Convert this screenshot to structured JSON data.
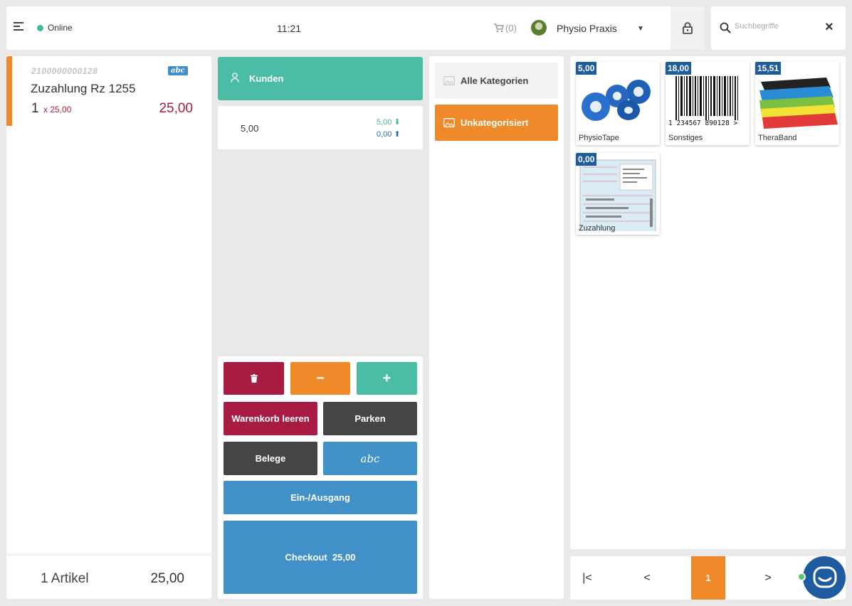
{
  "topbar": {
    "status": "Online",
    "time": "11:21",
    "cart_count": "(0)",
    "user_name": "Physio Praxis"
  },
  "search": {
    "placeholder": "Suchbegriffe",
    "clear": "×"
  },
  "cart": {
    "item": {
      "code": "2100000000128",
      "badge": "abc",
      "name": "Zuzahlung Rz 1255",
      "qty": "1",
      "unit": "x 25,00",
      "total": "25,00"
    },
    "footer": {
      "count": "1 Artikel",
      "sum": "25,00"
    }
  },
  "customer": {
    "label": "Kunden"
  },
  "payment": {
    "amount": "5,00",
    "in": "5,00",
    "out": "0,00"
  },
  "actions": {
    "minus": "−",
    "plus": "+",
    "clear_cart": "Warenkorb leeren",
    "park": "Parken",
    "receipts": "Belege",
    "abc": "abc",
    "cash_in_out": "Ein-/Ausgang",
    "checkout": "Checkout  25,00"
  },
  "categories": [
    {
      "label": "Alle Kategorien",
      "active": false
    },
    {
      "label": "Unkategorisiert",
      "active": true
    }
  ],
  "products": [
    {
      "price": "5,00",
      "name": "PhysioTape"
    },
    {
      "price": "18,00",
      "name": "Sonstiges",
      "barcode_text": "1 234567 890128 >"
    },
    {
      "price": "15,51",
      "name": "TheraBand"
    },
    {
      "price": "0,00",
      "name": "Zuzahlung"
    }
  ],
  "pager": {
    "first": "|<",
    "prev": "<",
    "current": "1",
    "next": ">"
  },
  "colors": {
    "accent": "#f0892a",
    "teal": "#4bbca5",
    "red": "#a81c44",
    "blue": "#4190c7",
    "price_badge": "#1e5c9f"
  }
}
